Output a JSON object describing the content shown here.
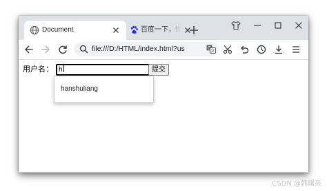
{
  "browser": {
    "tabs": [
      {
        "title": "Document",
        "active": true,
        "icon": "globe-icon"
      },
      {
        "title": "百度一下，你就知道",
        "active": false,
        "icon": "baidu-paw-icon"
      }
    ],
    "url": "file:///D:/HTML/index.html?us"
  },
  "form": {
    "label": "用户名：",
    "username_value": "h",
    "submit_label": "提交"
  },
  "autocomplete": {
    "suggestions": [
      "hanshuliang"
    ]
  },
  "watermark": "CSDN @韩曙亮",
  "colors": {
    "titlebar": "#dee1e6",
    "omnibox": "#f1f3f4",
    "baidu_blue": "#2932e1"
  }
}
